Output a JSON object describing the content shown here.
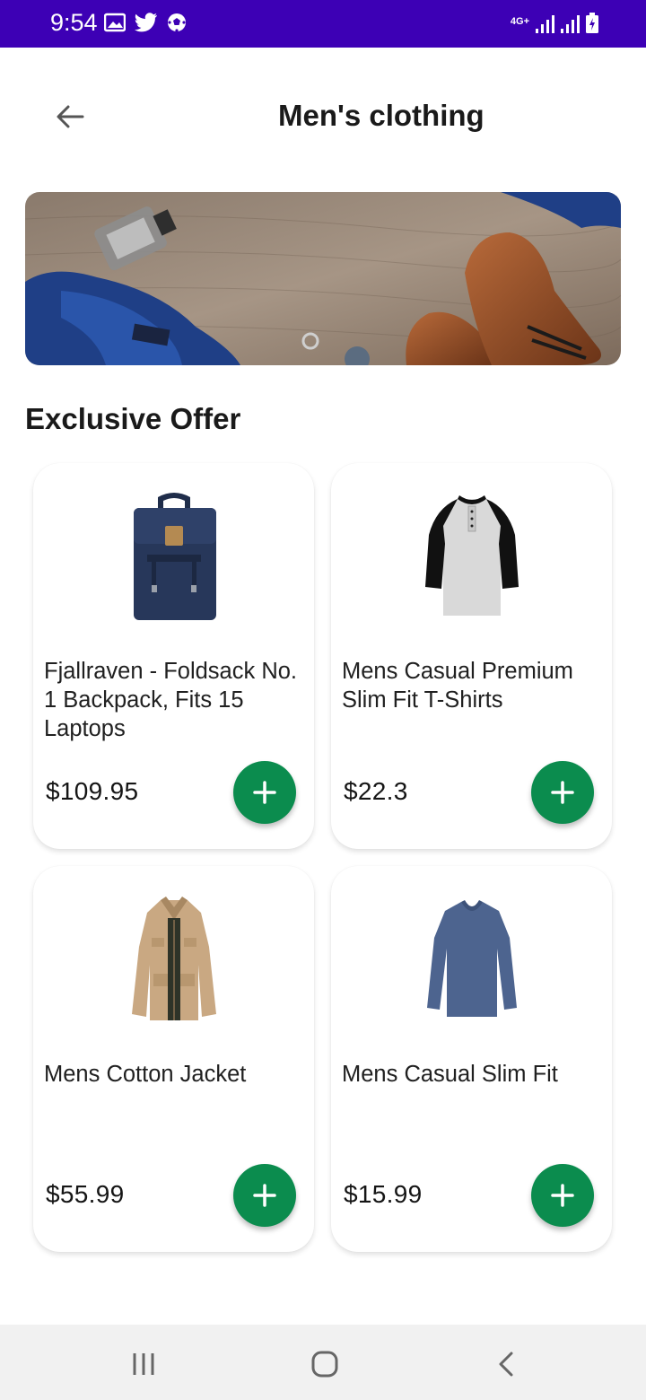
{
  "status_bar": {
    "time": "9:54",
    "left_icons": [
      "image-icon",
      "twitter-icon",
      "soccer-ball-icon"
    ],
    "right_icons": [
      "4g-icon",
      "signal-icon",
      "signal-icon",
      "battery-icon"
    ],
    "network_label": "4G+"
  },
  "header": {
    "back_icon": "arrow-left-icon",
    "title": "Men's clothing"
  },
  "banner": {
    "image": "mens-accessories-banner"
  },
  "section": {
    "title": "Exclusive Offer"
  },
  "products": [
    {
      "name": "Fjallraven - Foldsack No. 1 Backpack, Fits 15 Laptops",
      "price": "$109.95",
      "image": "backpack"
    },
    {
      "name": "Mens Casual Premium Slim Fit T-Shirts",
      "price": "$22.3",
      "image": "raglan-tshirt"
    },
    {
      "name": "Mens Cotton Jacket",
      "price": "$55.99",
      "image": "cotton-jacket"
    },
    {
      "name": "Mens Casual Slim Fit",
      "price": "$15.99",
      "image": "long-sleeve-shirt"
    }
  ],
  "colors": {
    "status_bar": "#3d00b5",
    "accent_green": "#0b8c4e",
    "navbar": "#f1f1f1"
  },
  "navbar": [
    "recents-icon",
    "home-icon",
    "back-icon"
  ]
}
